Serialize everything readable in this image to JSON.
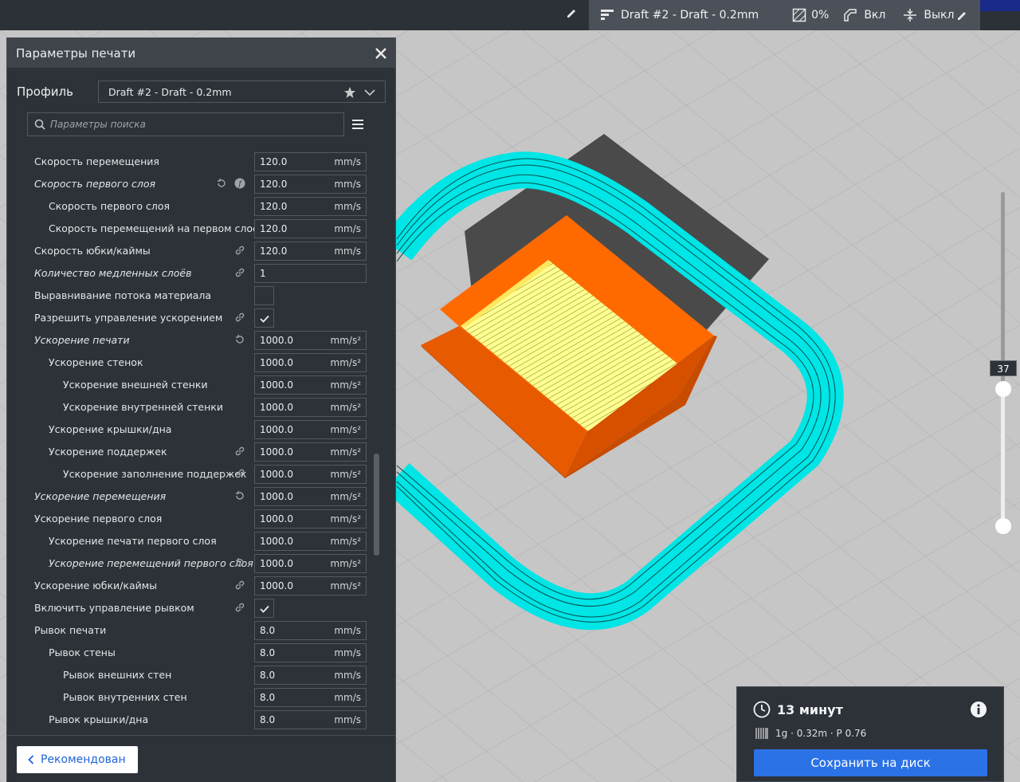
{
  "topbar": {
    "profile_name": "Draft #2 - Draft - 0.2mm",
    "infill": "0%",
    "support": "Вкл",
    "adhesion": "Выкл"
  },
  "panel": {
    "title": "Параметры печати",
    "profile_label": "Профиль",
    "profile_value": "Draft #2 - Draft - 0.2mm",
    "search_placeholder": "Параметры поиска",
    "footer_button": "Рекомендован",
    "settings": [
      {
        "label": "Скорость перемещения",
        "value": "120.0",
        "unit": "mm/s"
      },
      {
        "label": "Скорость первого слоя",
        "value": "120.0",
        "unit": "mm/s"
      },
      {
        "label": "Скорость первого слоя",
        "value": "120.0",
        "unit": "mm/s"
      },
      {
        "label": "Скорость перемещений на первом слое",
        "value": "120.0",
        "unit": "mm/s"
      },
      {
        "label": "Скорость юбки/каймы",
        "value": "120.0",
        "unit": "mm/s"
      },
      {
        "label": "Количество медленных слоёв",
        "value": "1",
        "unit": ""
      },
      {
        "label": "Выравнивание потока материала"
      },
      {
        "label": "Разрешить управление ускорением"
      },
      {
        "label": "Ускорение печати",
        "value": "1000.0",
        "unit": "mm/s²"
      },
      {
        "label": "Ускорение стенок",
        "value": "1000.0",
        "unit": "mm/s²"
      },
      {
        "label": "Ускорение внешней стенки",
        "value": "1000.0",
        "unit": "mm/s²"
      },
      {
        "label": "Ускорение внутренней стенки",
        "value": "1000.0",
        "unit": "mm/s²"
      },
      {
        "label": "Ускорение крышки/дна",
        "value": "1000.0",
        "unit": "mm/s²"
      },
      {
        "label": "Ускорение поддержек",
        "value": "1000.0",
        "unit": "mm/s²"
      },
      {
        "label": "Ускорение заполнение поддержек",
        "value": "1000.0",
        "unit": "mm/s²"
      },
      {
        "label": "Ускорение перемещения",
        "value": "1000.0",
        "unit": "mm/s²"
      },
      {
        "label": "Ускорение первого слоя",
        "value": "1000.0",
        "unit": "mm/s²"
      },
      {
        "label": "Ускорение печати первого слоя",
        "value": "1000.0",
        "unit": "mm/s²"
      },
      {
        "label": "Ускорение перемещений первого слоя",
        "value": "1000.0",
        "unit": "mm/s²"
      },
      {
        "label": "Ускорение юбки/каймы",
        "value": "1000.0",
        "unit": "mm/s²"
      },
      {
        "label": "Включить управление рывком"
      },
      {
        "label": "Рывок печати",
        "value": "8.0",
        "unit": "mm/s"
      },
      {
        "label": "Рывок стены",
        "value": "8.0",
        "unit": "mm/s"
      },
      {
        "label": "Рывок внешних стен",
        "value": "8.0",
        "unit": "mm/s"
      },
      {
        "label": "Рывок внутренних стен",
        "value": "8.0",
        "unit": "mm/s"
      },
      {
        "label": "Рывок крышки/дна",
        "value": "8.0",
        "unit": "mm/s"
      }
    ]
  },
  "layer_slider": {
    "current_layer": "37"
  },
  "summary": {
    "time": "13 минут",
    "material": "1g · 0.32m · P 0.76",
    "save_button": "Сохранить на диск"
  },
  "colors": {
    "skirt": "#00e5e5",
    "model": "#ff6a00",
    "top_skin": "#ffff88",
    "accent": "#2b72e6"
  }
}
